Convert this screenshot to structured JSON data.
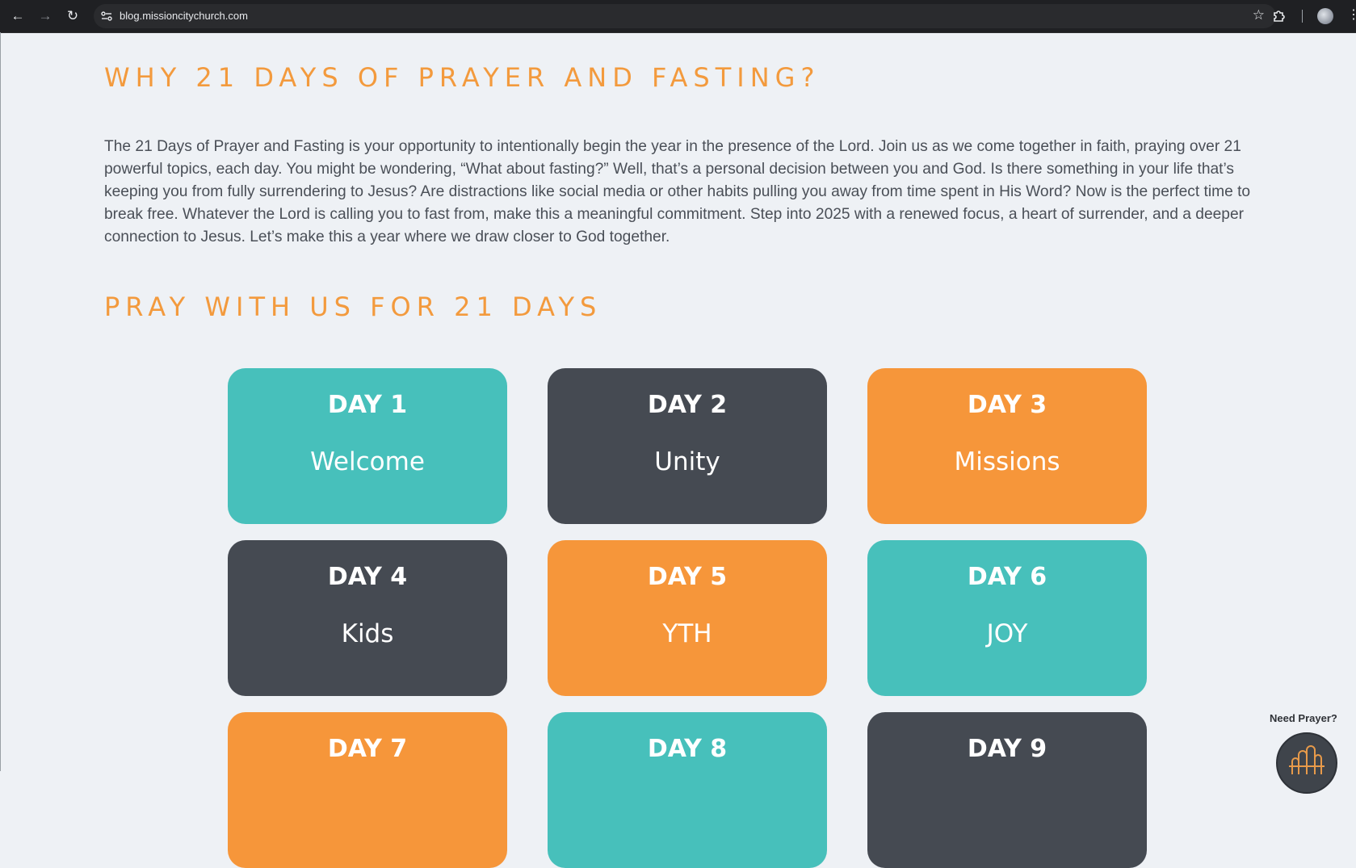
{
  "browser": {
    "url": "blog.missioncitychurch.com"
  },
  "sections": {
    "why_title": "WHY 21 DAYS OF PRAYER AND FASTING?",
    "why_body": "The 21 Days of Prayer and Fasting is your opportunity to intentionally begin the year in the presence of the Lord. Join us as we come together in faith, praying over 21 powerful topics, each day. You might be wondering, “What about fasting?” Well, that’s a personal decision between you and God. Is there something in your life that’s keeping you from fully surrendering to Jesus? Are distractions like social media or other habits pulling you away from time spent in His Word? Now is the perfect time to break free. Whatever the Lord is calling you to fast from, make this a meaningful commitment. Step into 2025 with a renewed focus, a heart of surrender, and a deeper connection to Jesus. Let’s make this a year where we draw closer to God together.",
    "pray_title": "PRAY WITH US FOR 21 DAYS"
  },
  "colors": {
    "teal": "#47c0bb",
    "charcoal": "#454a52",
    "orange": "#f6963a",
    "heading_orange": "#f39a3d"
  },
  "days": [
    {
      "day": "DAY 1",
      "topic": "Welcome",
      "color": "teal"
    },
    {
      "day": "DAY 2",
      "topic": "Unity",
      "color": "charcoal"
    },
    {
      "day": "DAY 3",
      "topic": "Missions",
      "color": "orange"
    },
    {
      "day": "DAY 4",
      "topic": "Kids",
      "color": "charcoal"
    },
    {
      "day": "DAY 5",
      "topic": "YTH",
      "color": "orange"
    },
    {
      "day": "DAY 6",
      "topic": "JOY",
      "color": "teal"
    },
    {
      "day": "DAY 7",
      "topic": "",
      "color": "orange"
    },
    {
      "day": "DAY 8",
      "topic": "",
      "color": "teal"
    },
    {
      "day": "DAY 9",
      "topic": "",
      "color": "charcoal"
    }
  ],
  "prayer_widget": {
    "label": "Need Prayer?",
    "icon": "church-logo-icon"
  }
}
